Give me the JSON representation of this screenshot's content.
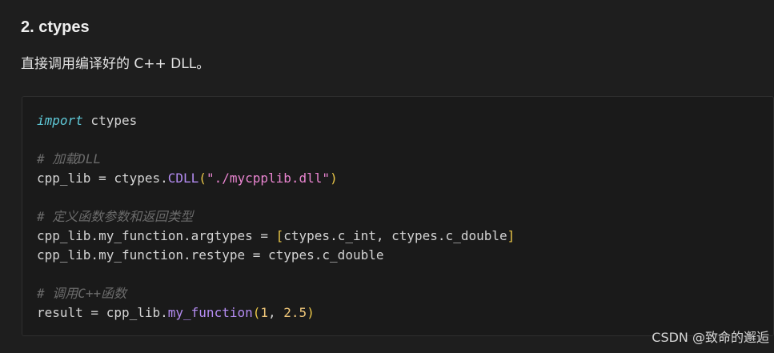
{
  "section": {
    "heading": "2. ctypes",
    "description": "直接调用编译好的 C++ DLL。"
  },
  "code": {
    "line1": {
      "keyword": "import",
      "rest": " ctypes"
    },
    "line2": {
      "comment": "# 加载DLL"
    },
    "line3": {
      "pre": "cpp_lib = ctypes.",
      "fn": "CDLL",
      "open": "(",
      "str": "\"./mycpplib.dll\"",
      "close": ")"
    },
    "line4": {
      "comment": "# 定义函数参数和返回类型"
    },
    "line5": {
      "pre": "cpp_lib.my_function.argtypes = ",
      "open": "[",
      "mid": "ctypes.c_int, ctypes.c_double",
      "close": "]"
    },
    "line6": {
      "text": "cpp_lib.my_function.restype = ctypes.c_double"
    },
    "line7": {
      "comment": "# 调用C++函数"
    },
    "line8": {
      "pre": "result = cpp_lib.",
      "fn": "my_function",
      "open": "(",
      "arg1": "1",
      "sep": ", ",
      "arg2": "2.5",
      "close": ")"
    }
  },
  "watermark": "CSDN @致命的邂逅"
}
